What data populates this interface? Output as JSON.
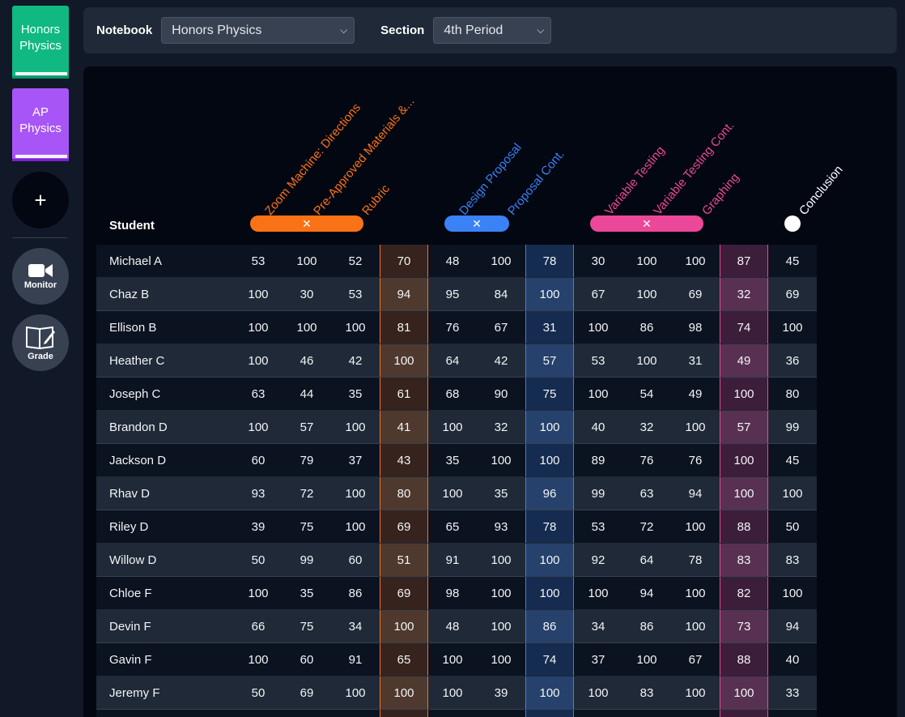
{
  "sidebar": {
    "notebooks": [
      {
        "label_line1": "Honors",
        "label_line2": "Physics",
        "color": "#10b981"
      },
      {
        "label_line1": "AP",
        "label_line2": "Physics",
        "color": "#a855f7"
      }
    ],
    "add_label": "+",
    "tools": [
      {
        "label": "Monitor",
        "icon": "video-camera-icon"
      },
      {
        "label": "Grade",
        "icon": "notebook-edit-icon"
      }
    ]
  },
  "topbar": {
    "notebook_label": "Notebook",
    "notebook_value": "Honors Physics",
    "section_label": "Section",
    "section_value": "4th Period"
  },
  "table": {
    "student_header": "Student",
    "columns": [
      {
        "title": "Zoom Machine: Directions",
        "group": "orange"
      },
      {
        "title": "Pre-Approved Materials &...",
        "group": "orange"
      },
      {
        "title": "Rubric",
        "group": "orange"
      },
      {
        "title": "Design Proposal",
        "group": "blue"
      },
      {
        "title": "Proposal Cont.",
        "group": "blue"
      },
      {
        "title": "Variable Testing",
        "group": "pink"
      },
      {
        "title": "Variable Testing Cont.",
        "group": "pink"
      },
      {
        "title": "Graphing",
        "group": "pink"
      },
      {
        "title": "Conclusion",
        "group": "white"
      }
    ],
    "group_toggle_symbol": "✕",
    "colors": {
      "orange": "#f97316",
      "blue": "#3b82f6",
      "pink": "#ec4899"
    },
    "rows": [
      {
        "name": "Michael A",
        "s": [
          53,
          100,
          52,
          70,
          48,
          100,
          78,
          30,
          100,
          100,
          87,
          45
        ]
      },
      {
        "name": "Chaz B",
        "s": [
          100,
          30,
          53,
          94,
          95,
          84,
          100,
          67,
          100,
          69,
          32,
          69
        ]
      },
      {
        "name": "Ellison B",
        "s": [
          100,
          100,
          100,
          81,
          76,
          67,
          31,
          100,
          86,
          98,
          74,
          100
        ]
      },
      {
        "name": "Heather C",
        "s": [
          100,
          46,
          42,
          100,
          64,
          42,
          57,
          53,
          100,
          31,
          49,
          36
        ]
      },
      {
        "name": "Joseph C",
        "s": [
          63,
          44,
          35,
          61,
          68,
          90,
          75,
          100,
          54,
          49,
          100,
          80
        ]
      },
      {
        "name": "Brandon D",
        "s": [
          100,
          57,
          100,
          41,
          100,
          32,
          100,
          40,
          32,
          100,
          57,
          99
        ]
      },
      {
        "name": "Jackson D",
        "s": [
          60,
          79,
          37,
          43,
          35,
          100,
          100,
          89,
          76,
          76,
          100,
          45
        ]
      },
      {
        "name": "Rhav D",
        "s": [
          93,
          72,
          100,
          80,
          100,
          35,
          96,
          99,
          63,
          94,
          100,
          100
        ]
      },
      {
        "name": "Riley D",
        "s": [
          39,
          75,
          100,
          69,
          65,
          93,
          78,
          53,
          72,
          100,
          88,
          50
        ]
      },
      {
        "name": "Willow D",
        "s": [
          50,
          99,
          60,
          51,
          91,
          100,
          100,
          92,
          64,
          78,
          83,
          83
        ]
      },
      {
        "name": "Chloe F",
        "s": [
          100,
          35,
          86,
          69,
          98,
          100,
          100,
          100,
          94,
          100,
          82,
          100
        ]
      },
      {
        "name": "Devin F",
        "s": [
          66,
          75,
          34,
          100,
          48,
          100,
          86,
          34,
          86,
          100,
          73,
          94
        ]
      },
      {
        "name": "Gavin F",
        "s": [
          100,
          60,
          91,
          65,
          100,
          100,
          74,
          37,
          100,
          67,
          88,
          40
        ]
      },
      {
        "name": "Jeremy F",
        "s": [
          50,
          69,
          100,
          100,
          100,
          39,
          100,
          100,
          83,
          100,
          100,
          33
        ]
      },
      {
        "name": "",
        "s": [
          "",
          "",
          "",
          "",
          "",
          "",
          "",
          "",
          "",
          "",
          "",
          ""
        ]
      }
    ]
  }
}
